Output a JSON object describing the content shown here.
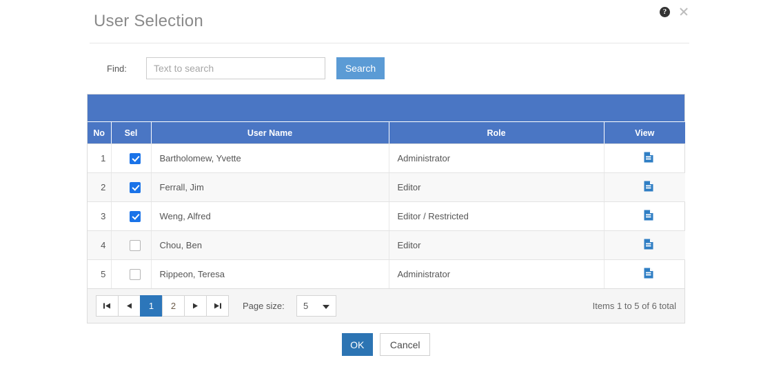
{
  "dialog": {
    "title": "User Selection",
    "help_icon": "help-circle-icon",
    "close_icon": "close-icon"
  },
  "search": {
    "find_label": "Find:",
    "input_value": "",
    "placeholder": "Text to search",
    "button_label": "Search"
  },
  "grid": {
    "columns": [
      "No",
      "Sel",
      "User Name",
      "Role",
      "View"
    ],
    "view_icon": "document-icon",
    "rows": [
      {
        "no": "1",
        "selected": true,
        "name": "Bartholomew, Yvette",
        "role": "Administrator"
      },
      {
        "no": "2",
        "selected": true,
        "name": "Ferrall, Jim",
        "role": "Editor"
      },
      {
        "no": "3",
        "selected": true,
        "name": "Weng, Alfred",
        "role": "Editor / Restricted"
      },
      {
        "no": "4",
        "selected": false,
        "name": "Chou, Ben",
        "role": "Editor"
      },
      {
        "no": "5",
        "selected": false,
        "name": "Rippeon, Teresa",
        "role": "Administrator"
      }
    ]
  },
  "pager": {
    "first_label": "⏮",
    "prev_label": "◄",
    "next_label": "►",
    "last_label": "⏭",
    "pages": [
      "1",
      "2"
    ],
    "active_page": "1",
    "page_size_label": "Page size:",
    "page_size_value": "5",
    "info": "Items 1 to 5 of 6 total"
  },
  "footer": {
    "ok_label": "OK",
    "cancel_label": "Cancel"
  },
  "colors": {
    "header_blue": "#4a76c4",
    "search_blue": "#5b9bd5",
    "ok_blue": "#2c74b3",
    "active_page_blue": "#2c76ba",
    "checkbox_blue": "#1a73e8",
    "view_icon_blue": "#2f7ec4"
  }
}
